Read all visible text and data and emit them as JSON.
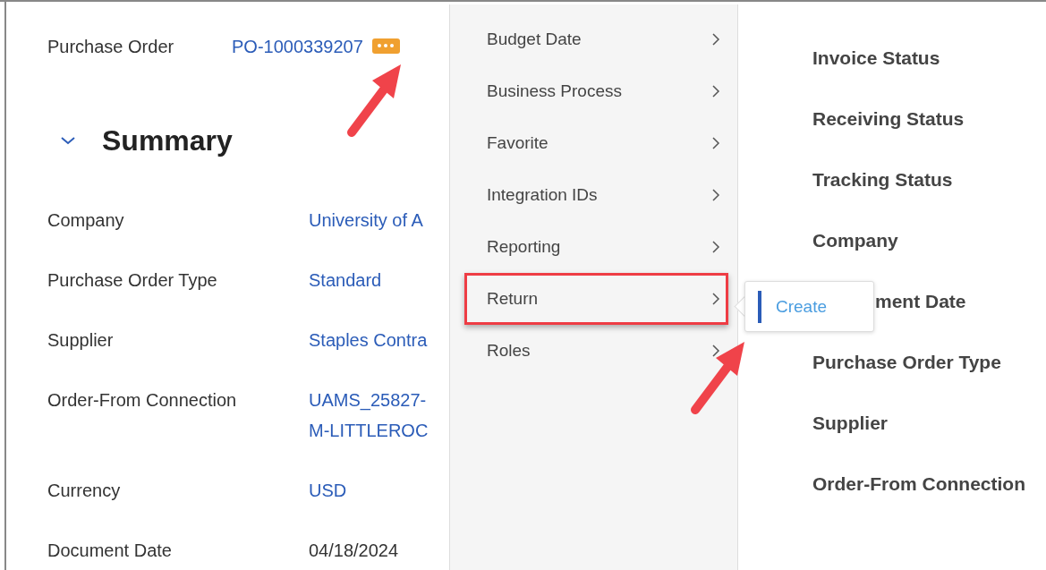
{
  "header": {
    "label": "Purchase Order",
    "value": "PO-1000339207"
  },
  "section": {
    "title": "Summary",
    "expanded": true
  },
  "fields": [
    {
      "label": "Company",
      "lines": [
        "University of A"
      ],
      "kind": "link"
    },
    {
      "label": "Purchase Order Type",
      "lines": [
        "Standard"
      ],
      "kind": "link"
    },
    {
      "label": "Supplier",
      "lines": [
        "Staples Contra"
      ],
      "kind": "link"
    },
    {
      "label": "Order-From Connection",
      "lines": [
        "UAMS_25827-",
        "M-LITTLEROC"
      ],
      "kind": "link"
    },
    {
      "label": "Currency",
      "lines": [
        "USD"
      ],
      "kind": "link"
    },
    {
      "label": "Document Date",
      "lines": [
        "04/18/2024"
      ],
      "kind": "text"
    }
  ],
  "menu": [
    {
      "label": "Budget Date",
      "highlighted": false
    },
    {
      "label": "Business Process",
      "highlighted": false
    },
    {
      "label": "Favorite",
      "highlighted": false
    },
    {
      "label": "Integration IDs",
      "highlighted": false
    },
    {
      "label": "Reporting",
      "highlighted": false
    },
    {
      "label": "Return",
      "highlighted": true
    },
    {
      "label": "Roles",
      "highlighted": false
    }
  ],
  "submenu": {
    "items": [
      "Create"
    ]
  },
  "columns": [
    {
      "label": "Invoice Status",
      "kind": "plain"
    },
    {
      "label": "Receiving Status",
      "kind": "plain"
    },
    {
      "label": "Tracking Status",
      "kind": "plain"
    },
    {
      "label": "Company",
      "kind": "plain"
    },
    {
      "label": "ment Date",
      "kind": "covered"
    },
    {
      "label": "Purchase Order Type",
      "kind": "plain"
    },
    {
      "label": "Supplier",
      "kind": "plain"
    },
    {
      "label": "Order-From Connection",
      "kind": "plain"
    }
  ]
}
